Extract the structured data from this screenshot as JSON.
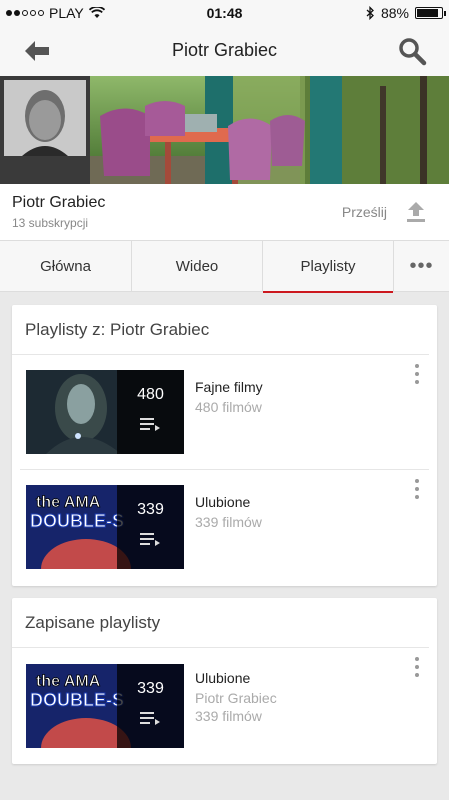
{
  "status": {
    "carrier": "PLAY",
    "time": "01:48",
    "battery": "88%",
    "battery_level": 0.88
  },
  "header": {
    "title": "Piotr Grabiec"
  },
  "channel": {
    "name": "Piotr Grabiec",
    "subscribers": "13 subskrypcji",
    "upload_label": "Prześlij"
  },
  "tabs": [
    {
      "label": "Główna"
    },
    {
      "label": "Wideo"
    },
    {
      "label": "Playlisty"
    }
  ],
  "sections": [
    {
      "title": "Playlisty z: Piotr Grabiec",
      "items": [
        {
          "count": "480",
          "title": "Fajne filmy",
          "sub": "480 filmów"
        },
        {
          "count": "339",
          "title": "Ulubione",
          "sub": "339 filmów"
        }
      ]
    },
    {
      "title": "Zapisane playlisty",
      "items": [
        {
          "count": "339",
          "title": "Ulubione",
          "author": "Piotr Grabiec",
          "sub": "339 filmów"
        }
      ]
    }
  ],
  "thumb_texts": {
    "a": "the AMA",
    "b": "DOUBLE-S"
  },
  "colors": {
    "accent": "#cc181e"
  }
}
